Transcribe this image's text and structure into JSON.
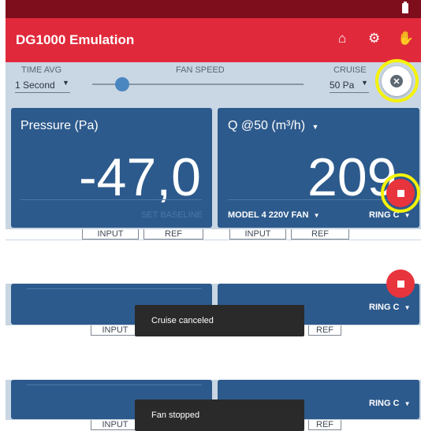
{
  "app": {
    "title": "DG1000 Emulation",
    "header_icons": [
      "home-icon",
      "gear-icon",
      "hand-icon"
    ]
  },
  "controls": {
    "time_avg_label": "TIME AVG",
    "time_avg_value": "1 Second",
    "fan_speed_label": "FAN SPEED",
    "fan_speed_level": 0.14,
    "cruise_label": "CRUISE",
    "cruise_value": "50 Pa"
  },
  "pressure_panel": {
    "title": "Pressure (Pa)",
    "value": "-47,0",
    "baseline_label": "SET BASELINE"
  },
  "flow_panel": {
    "title": "Q @50 (m³/h)",
    "value": "209",
    "fan_model": "MODEL 4 220V FAN",
    "ring": "RING C"
  },
  "tabs": {
    "input": "INPUT",
    "ref": "REF"
  },
  "snippets": [
    {
      "toast": "Cruise canceled",
      "ring": "RING C"
    },
    {
      "toast": "Fan stopped",
      "ring": "RING C"
    }
  ],
  "colors": {
    "app_bar": "#e02a3c",
    "status_bar": "#7e0e1c",
    "panel": "#2d5a8c",
    "highlight_ring": "#f4f20a",
    "fab": "#e8343c"
  }
}
